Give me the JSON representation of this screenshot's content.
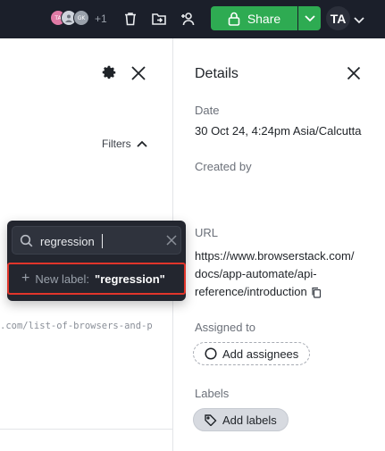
{
  "topbar": {
    "avatars": [
      {
        "initials": "TA",
        "color": "#e07aa6"
      },
      {
        "initials": "",
        "color": "#cfd4dc"
      },
      {
        "initials": "GK",
        "color": "#9aa1ab"
      }
    ],
    "extra_count": "+1",
    "share_label": "Share",
    "user_initials": "TA",
    "icons": [
      "trash-icon",
      "move-folder-icon",
      "add-person-icon",
      "lock-icon",
      "chevron-down-icon"
    ],
    "accent": "#2eab52",
    "background": "#1b1f2a"
  },
  "left_pane": {
    "filters_label": "Filters",
    "url_preview": ".com/list-of-browsers-and-p"
  },
  "popover": {
    "search_value": "regression",
    "new_label_prefix": "New label:",
    "new_label_value": "\"regression\"",
    "highlight_color": "#e0352b"
  },
  "details": {
    "title": "Details",
    "date_label": "Date",
    "date_value": "30 Oct 24, 4:24pm Asia/Calcutta",
    "created_by_label": "Created by",
    "url_label": "URL",
    "url_lines": [
      "https://www.browserstack.com/",
      "docs/app-automate/api-",
      "reference/introduction"
    ],
    "assigned_label": "Assigned to",
    "assignees_button": "Add assignees",
    "labels_label": "Labels",
    "labels_button": "Add labels"
  }
}
